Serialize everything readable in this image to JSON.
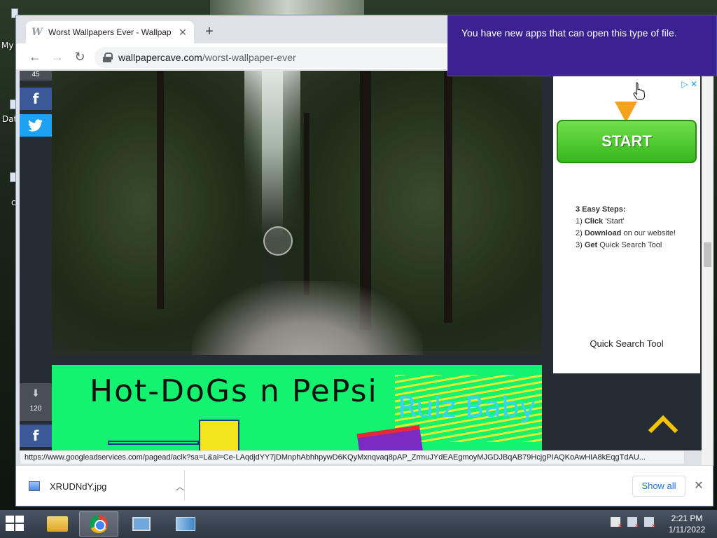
{
  "desktop": {
    "icon_labels": [
      "My",
      "Dat",
      "c"
    ]
  },
  "browser": {
    "tab": {
      "title": "Worst Wallpapers Ever - Wallpap",
      "favicon": "W"
    },
    "toolbar": {
      "back_icon": "back-arrow-icon",
      "forward_icon": "forward-arrow-icon",
      "reload_icon": "reload-icon",
      "url_host": "wallpapercave.com",
      "url_path": "/worst-wallpaper-ever"
    },
    "sidebar": {
      "top_count": "45",
      "bottom_count": "120",
      "facebook_label": "f"
    },
    "content": {
      "hotdog_text": "Hot-DoGs n PePsi",
      "rulz_text": "Rulz Baby"
    },
    "ad": {
      "start_label": "START",
      "steps_title": "3 Easy Steps:",
      "steps": [
        {
          "num": "1)",
          "bold": "Click",
          "rest": "'Start'"
        },
        {
          "num": "2)",
          "bold": "Download",
          "rest": "on our website!"
        },
        {
          "num": "3)",
          "bold": "Get",
          "rest": "Quick Search Tool"
        }
      ],
      "footer": "Quick Search Tool"
    },
    "status_url": "https://www.googleadservices.com/pagead/aclk?sa=L&ai=Ce-LAqdjdYY7jDMnphAbhhpywD6KQyMxnqvaq8pAP_ZrmuJYdEAEgmoyMJGDJBqAB79HcjgPIAQKoAwHIA8kEqgTdAU...",
    "downloads": {
      "file_name": "XRUDNdY.jpg",
      "show_all": "Show all"
    }
  },
  "toast": {
    "message": "You have new apps that can open this type of file."
  },
  "taskbar": {
    "time": "2:21 PM",
    "date": "1/11/2022"
  },
  "colors": {
    "toast_bg": "#3b2191",
    "start_green": "#36b81c",
    "link_blue": "#1a73e8",
    "facebook": "#3b5998",
    "twitter": "#1da1f2",
    "hotdog_bg": "#13f36f"
  }
}
